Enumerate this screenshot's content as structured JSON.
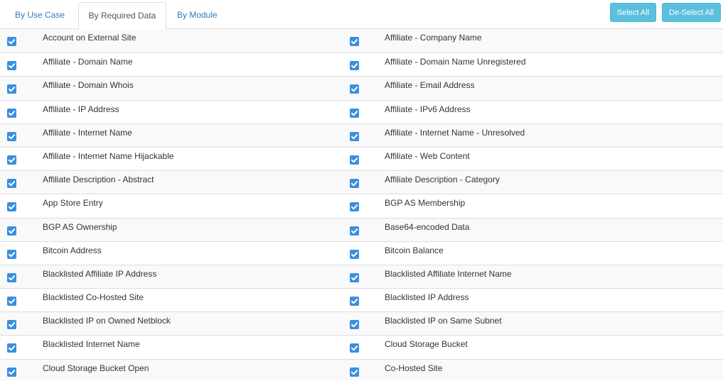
{
  "tabs": [
    {
      "label": "By Use Case",
      "active": false
    },
    {
      "label": "By Required Data",
      "active": true
    },
    {
      "label": "By Module",
      "active": false
    }
  ],
  "buttons": {
    "select_all": "Select All",
    "deselect_all": "De-Select All"
  },
  "colors": {
    "link": "#337ab7",
    "button_info": "#5bc0de",
    "checkbox": "#3a8fe0",
    "row_stripe": "#f9f9f9"
  },
  "rows": [
    {
      "left": {
        "label": "Account on External Site",
        "checked": true
      },
      "right": {
        "label": "Affiliate - Company Name",
        "checked": true
      }
    },
    {
      "left": {
        "label": "Affiliate - Domain Name",
        "checked": true
      },
      "right": {
        "label": "Affiliate - Domain Name Unregistered",
        "checked": true
      }
    },
    {
      "left": {
        "label": "Affiliate - Domain Whois",
        "checked": true
      },
      "right": {
        "label": "Affiliate - Email Address",
        "checked": true
      }
    },
    {
      "left": {
        "label": "Affiliate - IP Address",
        "checked": true
      },
      "right": {
        "label": "Affiliate - IPv6 Address",
        "checked": true
      }
    },
    {
      "left": {
        "label": "Affiliate - Internet Name",
        "checked": true
      },
      "right": {
        "label": "Affiliate - Internet Name - Unresolved",
        "checked": true
      }
    },
    {
      "left": {
        "label": "Affiliate - Internet Name Hijackable",
        "checked": true
      },
      "right": {
        "label": "Affiliate - Web Content",
        "checked": true
      }
    },
    {
      "left": {
        "label": "Affiliate Description - Abstract",
        "checked": true
      },
      "right": {
        "label": "Affiliate Description - Category",
        "checked": true
      }
    },
    {
      "left": {
        "label": "App Store Entry",
        "checked": true
      },
      "right": {
        "label": "BGP AS Membership",
        "checked": true
      }
    },
    {
      "left": {
        "label": "BGP AS Ownership",
        "checked": true
      },
      "right": {
        "label": "Base64-encoded Data",
        "checked": true
      }
    },
    {
      "left": {
        "label": "Bitcoin Address",
        "checked": true
      },
      "right": {
        "label": "Bitcoin Balance",
        "checked": true
      }
    },
    {
      "left": {
        "label": "Blacklisted Affiliate IP Address",
        "checked": true
      },
      "right": {
        "label": "Blacklisted Affiliate Internet Name",
        "checked": true
      }
    },
    {
      "left": {
        "label": "Blacklisted Co-Hosted Site",
        "checked": true
      },
      "right": {
        "label": "Blacklisted IP Address",
        "checked": true
      }
    },
    {
      "left": {
        "label": "Blacklisted IP on Owned Netblock",
        "checked": true
      },
      "right": {
        "label": "Blacklisted IP on Same Subnet",
        "checked": true
      }
    },
    {
      "left": {
        "label": "Blacklisted Internet Name",
        "checked": true
      },
      "right": {
        "label": "Cloud Storage Bucket",
        "checked": true
      }
    },
    {
      "left": {
        "label": "Cloud Storage Bucket Open",
        "checked": true
      },
      "right": {
        "label": "Co-Hosted Site",
        "checked": true
      }
    }
  ]
}
